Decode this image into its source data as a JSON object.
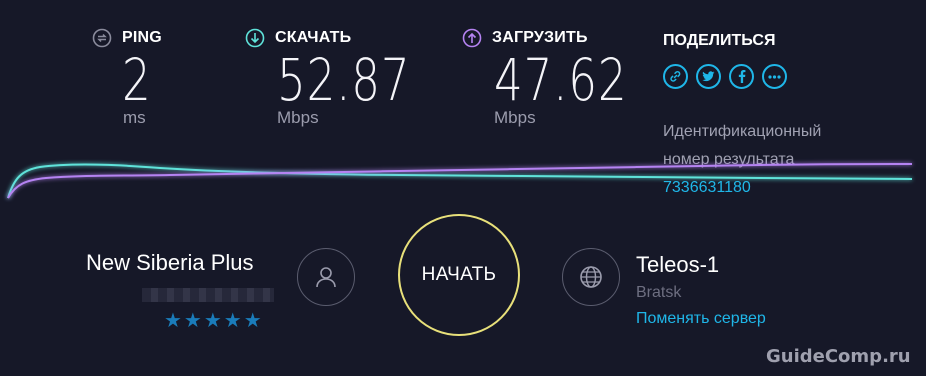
{
  "metrics": {
    "ping": {
      "label": "PING",
      "value": "2",
      "unit": "ms",
      "icon": "ping-icon",
      "color": "#8a8b9c"
    },
    "download": {
      "label": "СКАЧАТЬ",
      "value": "52.87",
      "unit": "Mbps",
      "icon": "download-arrow-icon",
      "color": "#5fe3da"
    },
    "upload": {
      "label": "ЗАГРУЗИТЬ",
      "value": "47.62",
      "unit": "Mbps",
      "icon": "upload-arrow-icon",
      "color": "#b583f2"
    }
  },
  "share": {
    "title": "ПОДЕЛИТЬСЯ",
    "icons": [
      "link-icon",
      "twitter-icon",
      "facebook-icon",
      "more-icon"
    ]
  },
  "result": {
    "label": "Идентификационный номер результата",
    "id": "7336631180"
  },
  "isp": {
    "name": "New Siberia Plus",
    "rating_stars": 5,
    "stars_text": "★★★★★"
  },
  "go_button": {
    "label": "НАЧАТЬ"
  },
  "server": {
    "name": "Teleos-1",
    "location": "Bratsk",
    "change_label": "Поменять сервер"
  },
  "colors": {
    "background": "#161828",
    "accent": "#1fb6e8",
    "download": "#5fe3da",
    "upload": "#b583f2",
    "go_ring": "#e8e07a"
  },
  "watermark": "GuideComp.ru"
}
